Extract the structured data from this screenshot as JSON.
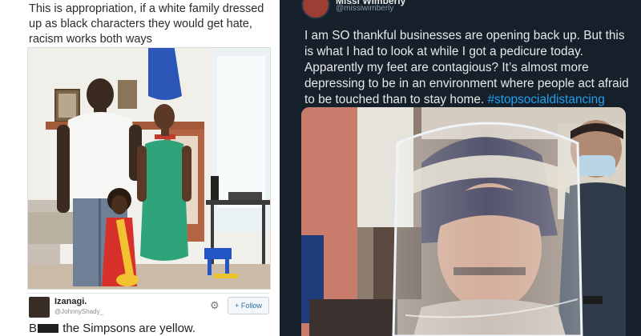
{
  "left_post": {
    "caption": "This is appropriation, if a white family dressed up as black characters they would get hate, racism works both ways",
    "tweet": {
      "display_name": "Izanagi.",
      "handle": "@JohnnyShady_",
      "follow_label": "Follow",
      "reply_prefix": "B",
      "reply_suffix": "the Simpsons are yellow."
    }
  },
  "right_post": {
    "display_name": "Missi Wimberly",
    "handle": "@missiwimberly",
    "text": "I am SO thankful businesses are opening back up. But this is what I had to look at while I got a pedicure today. Apparently my feet are contagious? It’s almost more depressing to be in an environment where people act afraid to be touched than to stay home.",
    "hashtag": "#stopsocialdistancing",
    "hashtag_color": "#1da1f2"
  },
  "colors": {
    "right_background": "#15202b",
    "marge_hair": "#2c57b8",
    "dress": "#2fa37a"
  },
  "icons": {
    "settings": "gear-icon",
    "follow": "add-user-icon"
  }
}
